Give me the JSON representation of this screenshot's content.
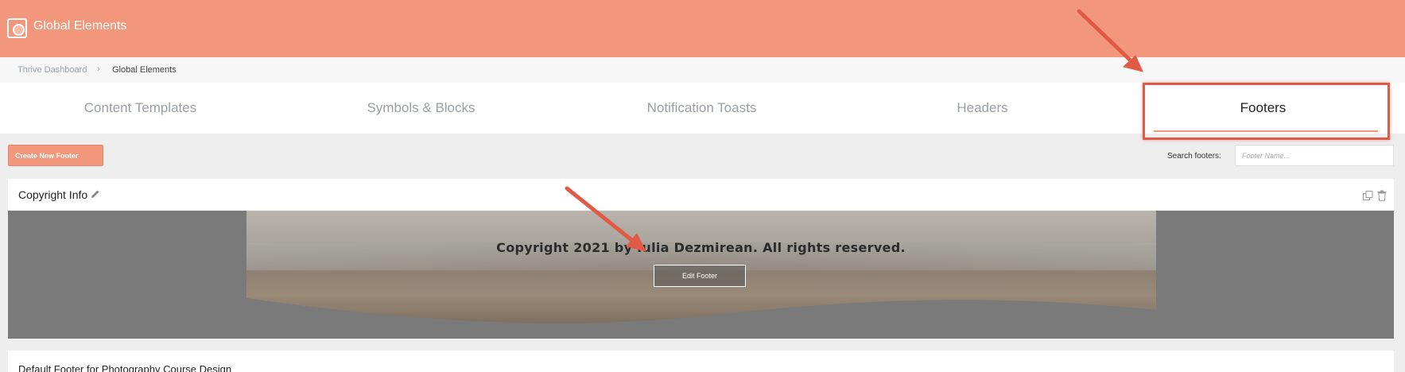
{
  "app": {
    "title": "Global Elements",
    "logo_icon": "thrive-logo-icon"
  },
  "breadcrumb": {
    "parent": "Thrive Dashboard",
    "separator": "›",
    "current": "Global Elements"
  },
  "tabs": [
    {
      "label": "Content Templates",
      "active": false
    },
    {
      "label": "Symbols & Blocks",
      "active": false
    },
    {
      "label": "Notification Toasts",
      "active": false
    },
    {
      "label": "Headers",
      "active": false
    },
    {
      "label": "Footers",
      "active": true
    }
  ],
  "toolbar": {
    "create_label": "Create New Footer",
    "search_label": "Search footers:",
    "search_placeholder": "Footer Name..."
  },
  "footers": [
    {
      "title": "Copyright Info",
      "preview_text": "Copyright 2021 by Iulia Dezmirean. All rights reserved.",
      "edit_label": "Edit Footer"
    },
    {
      "title": "Default Footer for Photography Course Design"
    }
  ],
  "colors": {
    "accent": "#f2977b",
    "highlight": "#e05a46"
  }
}
